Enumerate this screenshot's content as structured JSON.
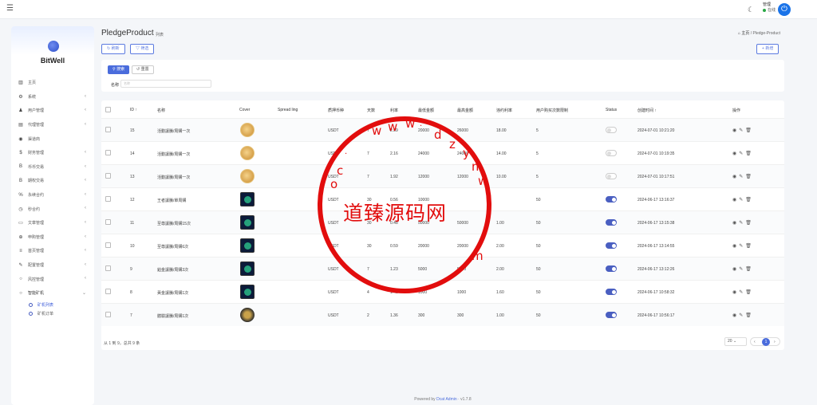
{
  "topbar": {
    "user_name": "管理",
    "status": "在线"
  },
  "sidebar": {
    "brand": "BitWell",
    "items": [
      {
        "label": "主页",
        "icon": "chart-icon",
        "arrow": ""
      },
      {
        "label": "系统",
        "icon": "gear-icon",
        "arrow": "‹"
      },
      {
        "label": "用户管理",
        "icon": "user-icon",
        "arrow": "‹"
      },
      {
        "label": "代理管理",
        "icon": "id-card-icon",
        "arrow": "‹"
      },
      {
        "label": "渠道商",
        "icon": "person-circle-icon",
        "arrow": ""
      },
      {
        "label": "财务管理",
        "icon": "dollar-icon",
        "arrow": "‹"
      },
      {
        "label": "币币交易",
        "icon": "bitcoin-icon",
        "arrow": "‹"
      },
      {
        "label": "期权交易",
        "icon": "bitcoin-icon",
        "arrow": "‹"
      },
      {
        "label": "永续合约",
        "icon": "percent-icon",
        "arrow": "‹"
      },
      {
        "label": "秒合约",
        "icon": "clock-icon",
        "arrow": "‹"
      },
      {
        "label": "文章管理",
        "icon": "book-icon",
        "arrow": "‹"
      },
      {
        "label": "申购管理",
        "icon": "crosshair-icon",
        "arrow": "‹"
      },
      {
        "label": "首页管理",
        "icon": "list-icon",
        "arrow": "‹"
      },
      {
        "label": "配置管理",
        "icon": "wrench-icon",
        "arrow": "‹"
      },
      {
        "label": "风控管理",
        "icon": "circle-icon",
        "arrow": "‹"
      },
      {
        "label": "智能矿机",
        "icon": "circle-icon",
        "arrow": "⌄"
      }
    ],
    "sub_items": [
      {
        "label": "矿机列表"
      },
      {
        "label": "矿机订单"
      }
    ]
  },
  "header": {
    "title": "PledgeProduct",
    "subtitle": "列表",
    "crumb_home": "主页",
    "crumb_sep": "/",
    "crumb_current": "Pledge-Product"
  },
  "toolbar": {
    "refresh": "刷新",
    "filter": "筛选",
    "add": "新增"
  },
  "filter": {
    "search": "搜索",
    "reset": "重置",
    "name_label": "名称",
    "name_placeholder": "名称"
  },
  "table": {
    "headers": {
      "id": "ID ↑",
      "name": "名称",
      "cover": "Cover",
      "spread": "Spread ling",
      "currency": "质押币种",
      "days": "天数",
      "rate": "利率",
      "min": "最低金额",
      "max": "最高金额",
      "penalty": "违约利率",
      "limit": "用户购买次数限制",
      "status": "Status",
      "created": "创建时间 ↑",
      "actions": "操作"
    },
    "rows": [
      {
        "id": "15",
        "name": "活動讓騰/周購一次",
        "cover": "gold",
        "currency": "USDT",
        "days": "7",
        "rate": "2.59",
        "min": "20000",
        "max": "26000",
        "penalty": "18.00",
        "limit": "5",
        "status": false,
        "created": "2024-07-01 10:21:20"
      },
      {
        "id": "14",
        "name": "活動讓騰/周購一次",
        "cover": "gold",
        "currency": "USDT",
        "days": "7",
        "rate": "2.16",
        "min": "24000",
        "max": "24000",
        "penalty": "14.00",
        "limit": "5",
        "status": false,
        "created": "2024-07-01 10:19:35"
      },
      {
        "id": "13",
        "name": "活動讓騰/周購一次",
        "cover": "gold",
        "currency": "USDT",
        "days": "7",
        "rate": "1.92",
        "min": "12000",
        "max": "12000",
        "penalty": "10.00",
        "limit": "5",
        "status": false,
        "created": "2024-07-01 10:17:51"
      },
      {
        "id": "12",
        "name": "王者讓騰/單周購",
        "cover": "usdt",
        "currency": "USDT",
        "days": "30",
        "rate": "0.56",
        "min": "10000",
        "max": "",
        "penalty": "",
        "limit": "50",
        "status": true,
        "created": "2024-06-17 13:16:37"
      },
      {
        "id": "11",
        "name": "至尊讓騰/周購15次",
        "cover": "usdt",
        "currency": "USDT",
        "days": "30",
        "rate": "0.48",
        "min": "50000",
        "max": "50000",
        "penalty": "1.00",
        "limit": "50",
        "status": true,
        "created": "2024-06-17 13:15:38"
      },
      {
        "id": "10",
        "name": "至尊讓騰/周購6次",
        "cover": "usdt",
        "currency": "USDT",
        "days": "30",
        "rate": "0.59",
        "min": "20000",
        "max": "20000",
        "penalty": "2.00",
        "limit": "50",
        "status": true,
        "created": "2024-06-17 13:14:55"
      },
      {
        "id": "9",
        "name": "鉑金讓騰/周購3次",
        "cover": "usdt",
        "currency": "USDT",
        "days": "7",
        "rate": "1.23",
        "min": "5000",
        "max": "5000",
        "penalty": "2.00",
        "limit": "50",
        "status": true,
        "created": "2024-06-17 13:12:26"
      },
      {
        "id": "8",
        "name": "黃金讓騰/周購1次",
        "cover": "usdt",
        "currency": "USDT",
        "days": "4",
        "rate": "1.40",
        "min": "1000",
        "max": "1000",
        "penalty": "1.60",
        "limit": "50",
        "status": true,
        "created": "2024-06-17 10:58:32"
      },
      {
        "id": "7",
        "name": "體驗讓騰/周購1次",
        "cover": "tt",
        "currency": "USDT",
        "days": "2",
        "rate": "1.36",
        "min": "300",
        "max": "300",
        "penalty": "1.00",
        "limit": "50",
        "status": true,
        "created": "2024-06-17 10:56:17"
      }
    ]
  },
  "pagination": {
    "info": "从 1 到 9，总共 9 条",
    "per_page": "20",
    "current": "1"
  },
  "footer": {
    "powered": "Powered by",
    "brand": "Dcat Admin",
    "version": "· v1.7.8"
  },
  "watermark": {
    "text": "道臻源码网",
    "url": "www.dzymw.com"
  }
}
